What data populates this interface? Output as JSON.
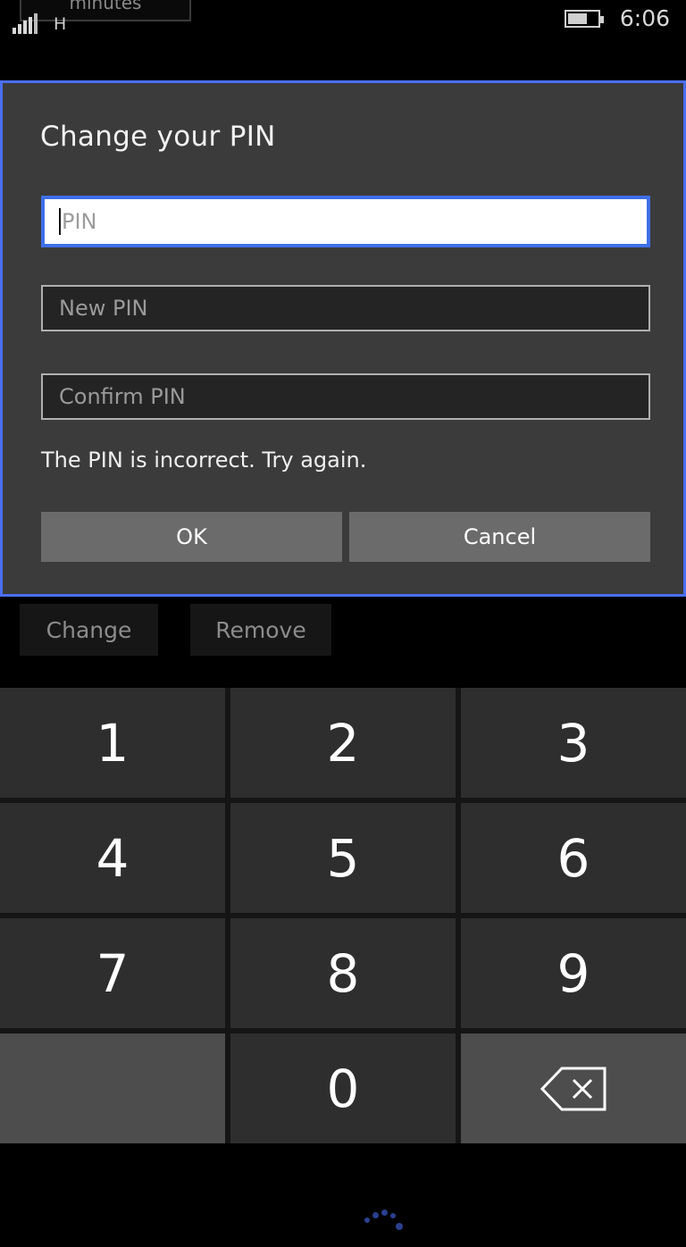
{
  "status_bar": {
    "signal_icon": "signal-bars-icon",
    "signal_bars": 5,
    "network_type": "H",
    "battery_icon": "battery-icon",
    "battery_level_pct": 60,
    "time": "6:06"
  },
  "ghost_popup": {
    "text": "minutes",
    "note": "partially cut off at top of screen"
  },
  "dialog": {
    "title": "Change your PIN",
    "accent_color": "#4a6ff0",
    "background_color": "#3b3b3b",
    "fields": [
      {
        "name": "pin",
        "placeholder": "PIN",
        "value": "",
        "focused": true
      },
      {
        "name": "new_pin",
        "placeholder": "New PIN",
        "value": "",
        "focused": false
      },
      {
        "name": "confirm_pin",
        "placeholder": "Confirm PIN",
        "value": "",
        "focused": false
      }
    ],
    "error_message": "The PIN is incorrect. Try again.",
    "buttons": {
      "ok": "OK",
      "cancel": "Cancel"
    }
  },
  "background_row": {
    "change_button": "Change",
    "remove_button": "Remove",
    "spinner_icon": "loading-spinner-icon",
    "spinner_color": "#2b3f8f"
  },
  "keypad": {
    "keys": [
      {
        "label": "1",
        "type": "digit"
      },
      {
        "label": "2",
        "type": "digit"
      },
      {
        "label": "3",
        "type": "digit"
      },
      {
        "label": "4",
        "type": "digit"
      },
      {
        "label": "5",
        "type": "digit"
      },
      {
        "label": "6",
        "type": "digit"
      },
      {
        "label": "7",
        "type": "digit"
      },
      {
        "label": "8",
        "type": "digit"
      },
      {
        "label": "9",
        "type": "digit"
      },
      {
        "label": "",
        "type": "blank"
      },
      {
        "label": "0",
        "type": "digit"
      },
      {
        "label": "",
        "type": "backspace",
        "icon": "backspace-icon"
      }
    ]
  }
}
